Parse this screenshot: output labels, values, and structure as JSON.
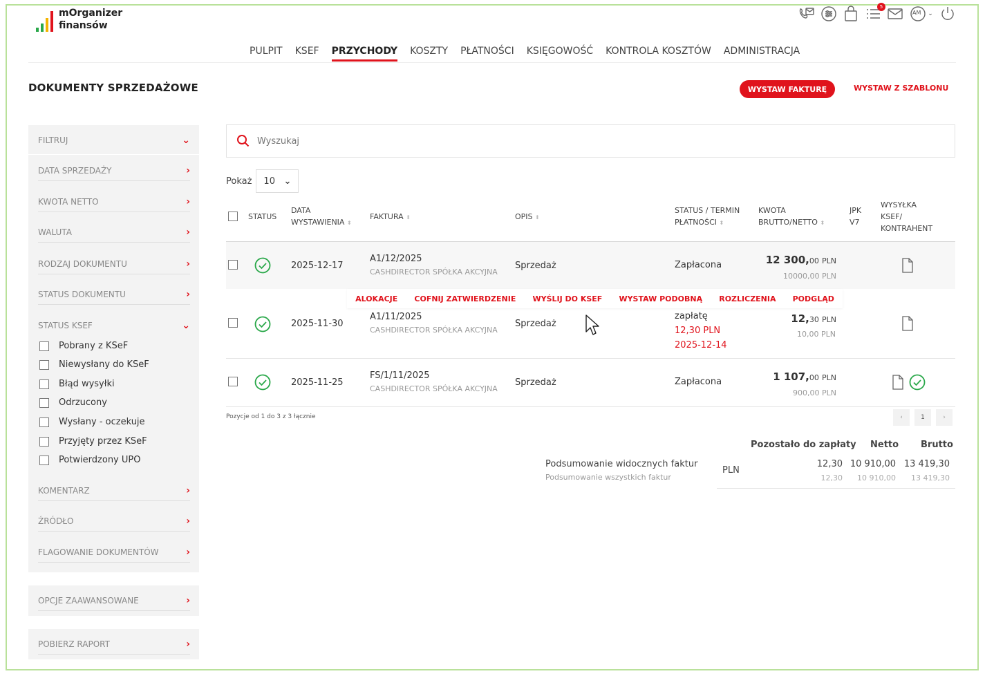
{
  "app": {
    "name_line1": "mOrganizer",
    "name_line2": "finansów",
    "notifications": "5",
    "user_initials": "AM"
  },
  "nav": [
    "PULPIT",
    "KSEF",
    "PRZYCHODY",
    "KOSZTY",
    "PŁATNOŚCI",
    "KSIĘGOWOŚĆ",
    "KONTROLA KOSZTÓW",
    "ADMINISTRACJA"
  ],
  "page": {
    "title": "DOKUMENTY SPRZEDAŻOWE",
    "primary_button": "WYSTAW FAKTURĘ",
    "secondary_link": "WYSTAW Z SZABLONU"
  },
  "sidebar": {
    "filter": "FILTRUJ",
    "items_top": [
      "DATA SPRZEDAŻY",
      "KWOTA NETTO",
      "WALUTA",
      "RODZAJ DOKUMENTU",
      "STATUS DOKUMENTU"
    ],
    "ksef_status": "STATUS KSEF",
    "ksef_options": [
      "Pobrany z KSeF",
      "Niewysłany do KSeF",
      "Błąd wysyłki",
      "Odrzucony",
      "Wysłany - oczekuje",
      "Przyjęty przez KSeF",
      "Potwierdzony UPO"
    ],
    "items_bottom": [
      "KOMENTARZ",
      "ŹRÓDŁO",
      "FLAGOWANIE DOKUMENTÓW"
    ],
    "advanced": "OPCJE ZAAWANSOWANE",
    "report": "POBIERZ RAPORT"
  },
  "search": {
    "placeholder": "Wyszukaj"
  },
  "pager_size": {
    "label": "Pokaż",
    "value": "10"
  },
  "table": {
    "headers": {
      "status": "STATUS",
      "date_1": "DATA",
      "date_2": "WYSTAWIENIA",
      "invoice": "FAKTURA",
      "desc": "OPIS",
      "pay_1": "STATUS / TERMIN",
      "pay_2": "PŁATNOŚCI",
      "amount_1": "KWOTA",
      "amount_2": "BRUTTO/NETTO",
      "jpk_1": "JPK",
      "jpk_2": "V7",
      "ksef_1": "WYSYŁKA",
      "ksef_2": "KSEF/",
      "ksef_3": "KONTRAHENT"
    },
    "rows": [
      {
        "date": "2025-12-17",
        "invoice": "A1/12/2025",
        "client": "CASHDIRECTOR SPÓŁKA AKCYJNA",
        "desc": "Sprzedaż",
        "pay_status": "Zapłacona",
        "gross_main": "12 300,",
        "gross_dec": "00",
        "currency": "PLN",
        "net": "10000,00 PLN"
      },
      {
        "date": "2025-11-30",
        "invoice": "A1/11/2025",
        "client": "CASHDIRECTOR SPÓŁKA AKCYJNA",
        "desc": "Sprzedaż",
        "pay_status": "zapłatę",
        "pay_amount": "12,30 PLN",
        "pay_date": "2025-12-14",
        "gross_main": "12,",
        "gross_dec": "30",
        "currency": "PLN",
        "net": "10,00 PLN"
      },
      {
        "date": "2025-11-25",
        "invoice": "FS/1/11/2025",
        "client": "CASHDIRECTOR SPÓŁKA AKCYJNA",
        "desc": "Sprzedaż",
        "pay_status": "Zapłacona",
        "gross_main": "1 107,",
        "gross_dec": "00",
        "currency": "PLN",
        "net": "900,00 PLN"
      }
    ],
    "row_actions": [
      "ALOKACJE",
      "COFNIJ ZATWIERDZENIE",
      "WYŚLIJ DO KSEF",
      "WYSTAW PODOBNĄ",
      "ROZLICZENIA",
      "PODGLĄD"
    ]
  },
  "pagination": {
    "info": "Pozycje od 1 do 3 z 3 łącznie",
    "prev": "‹",
    "current": "1",
    "next": "›"
  },
  "summary": {
    "head_remaining": "Pozostało do zapłaty",
    "head_net": "Netto",
    "head_gross": "Brutto",
    "visible_label": "Podsumowanie widocznych faktur",
    "all_label": "Podsumowanie wszystkich faktur",
    "currency": "PLN",
    "visible": {
      "remaining": "12,30",
      "net": "10 910,00",
      "gross": "13 419,30"
    },
    "all": {
      "remaining": "12,30",
      "net": "10 910,00",
      "gross": "13 419,30"
    }
  },
  "colors": {
    "accent": "#e0131c",
    "frame": "#b9e19a",
    "sidebar_bg": "#f3f3f3",
    "ok_green": "#2aa84a"
  }
}
